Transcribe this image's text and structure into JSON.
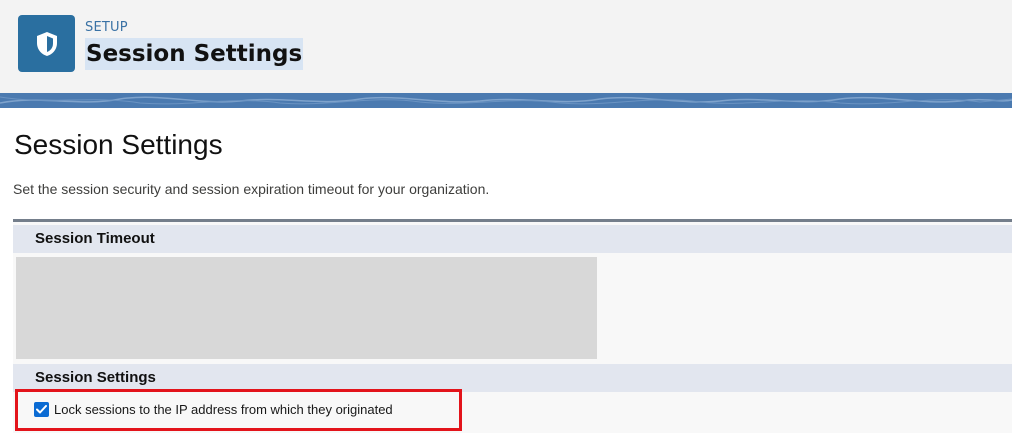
{
  "header": {
    "section_label": "SETUP",
    "title": "Session Settings",
    "app_icon": "shield-icon"
  },
  "page": {
    "title": "Session Settings",
    "description": "Set the session security and session expiration timeout for your organization."
  },
  "sections": [
    {
      "label": "Session Timeout"
    },
    {
      "label": "Session Settings"
    }
  ],
  "settings": {
    "lock_ip": {
      "label": "Lock sessions to the IP address from which they originated",
      "checked": true
    }
  },
  "colors": {
    "app_icon_bg": "#2a6fa0",
    "banner": "#4b7ab0",
    "checkbox": "#0b6bd3",
    "highlight": "#e3141b"
  }
}
